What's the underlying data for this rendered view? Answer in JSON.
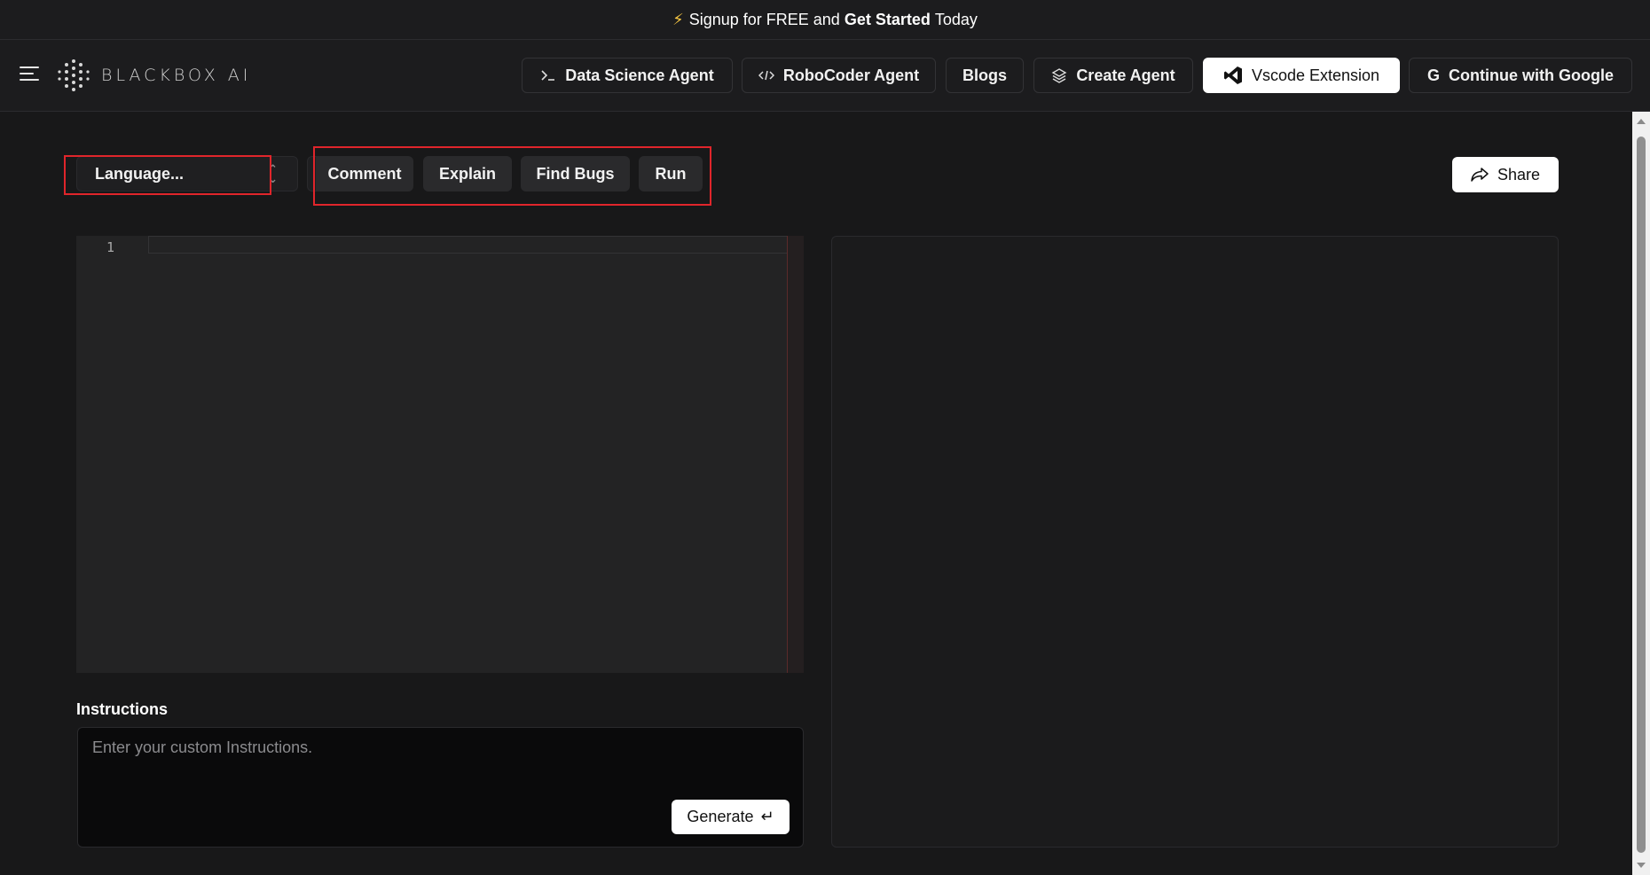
{
  "banner": {
    "icon": "lightning-icon",
    "prefix": "Signup for FREE and",
    "bold": "Get Started",
    "suffix": "Today"
  },
  "header": {
    "logo_text": "BLACKBOX AI",
    "nav": [
      {
        "label": "Data Science Agent",
        "icon": "terminal-icon"
      },
      {
        "label": "RoboCoder Agent",
        "icon": "code-icon"
      },
      {
        "label": "Blogs"
      },
      {
        "label": "Create Agent",
        "icon": "layers-icon"
      },
      {
        "label": "Vscode Extension",
        "icon": "vscode-icon"
      },
      {
        "label": "Continue with Google",
        "icon": "google-icon"
      }
    ]
  },
  "toolbar": {
    "language_placeholder": "Language...",
    "actions": [
      "Comment",
      "Explain",
      "Find Bugs",
      "Run"
    ],
    "share_label": "Share"
  },
  "editor": {
    "line_numbers": [
      "1"
    ]
  },
  "instructions": {
    "label": "Instructions",
    "placeholder": "Enter your custom Instructions.",
    "generate_label": "Generate"
  },
  "colors": {
    "background": "#181819",
    "annotation_red": "#e0252b",
    "accent_bolt": "#f5c542"
  }
}
